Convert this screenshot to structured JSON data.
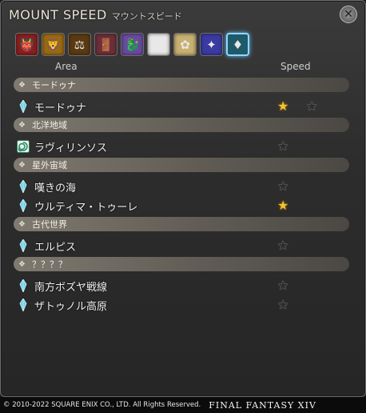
{
  "window": {
    "title_en": "MOUNT SPEED",
    "title_jp": "マウントスピード",
    "close_icon": "✕"
  },
  "tabs": [
    {
      "icon": "rising-flag-icon",
      "glyph": "👹",
      "bg": "#8a1f1f"
    },
    {
      "icon": "lion-crest-icon",
      "glyph": "🦁",
      "bg": "#9a6a12"
    },
    {
      "icon": "scales-crest-icon",
      "glyph": "⚖",
      "bg": "#5a3a12"
    },
    {
      "icon": "door-crest-icon",
      "glyph": "🚪",
      "bg": "#6b2e3a"
    },
    {
      "icon": "dragon-crest-icon",
      "glyph": "🐉",
      "bg": "#6a4aa0"
    },
    {
      "icon": "spiral-crest-icon",
      "glyph": "◎",
      "bg": "#e8e8e8"
    },
    {
      "icon": "flower-crest-icon",
      "glyph": "✿",
      "bg": "#c8b070"
    },
    {
      "icon": "star-burst-crest-icon",
      "glyph": "✦",
      "bg": "#3a3aa0"
    },
    {
      "icon": "crystal-crest-icon",
      "glyph": "♦",
      "bg": "#1f5a6a",
      "active": true
    }
  ],
  "headers": {
    "area": "Area",
    "speed": "Speed"
  },
  "groups": [
    {
      "name": "モードゥナ",
      "rows": [
        {
          "label": "モードゥナ",
          "icon": "crystal-icon",
          "stars": [
            "filled",
            "empty"
          ]
        }
      ]
    },
    {
      "name": "北洋地域",
      "rows": [
        {
          "label": "ラヴィリンソス",
          "icon": "spiral-icon",
          "stars": [
            "empty"
          ]
        }
      ]
    },
    {
      "name": "星外宙域",
      "rows": [
        {
          "label": "嘆きの海",
          "icon": "crystal-icon",
          "stars": [
            "empty"
          ]
        },
        {
          "label": "ウルティマ・トゥーレ",
          "icon": "crystal-icon",
          "stars": [
            "filled"
          ]
        }
      ]
    },
    {
      "name": "古代世界",
      "rows": [
        {
          "label": "エルピス",
          "icon": "crystal-icon",
          "stars": [
            "empty"
          ]
        }
      ]
    },
    {
      "name": "？？？？",
      "rows": [
        {
          "label": "南方ボズヤ戦線",
          "icon": "crystal-icon",
          "stars": [
            "empty"
          ]
        },
        {
          "label": "ザトゥノル高原",
          "icon": "crystal-icon",
          "stars": [
            "empty"
          ]
        }
      ]
    }
  ],
  "footer": {
    "copyright": "© 2010-2022 SQUARE ENIX CO., LTD. All Rights Reserved.",
    "logo": "FINAL FANTASY XIV"
  },
  "colors": {
    "star_filled": "#f1c232",
    "accent_active": "#8fd8ff"
  }
}
